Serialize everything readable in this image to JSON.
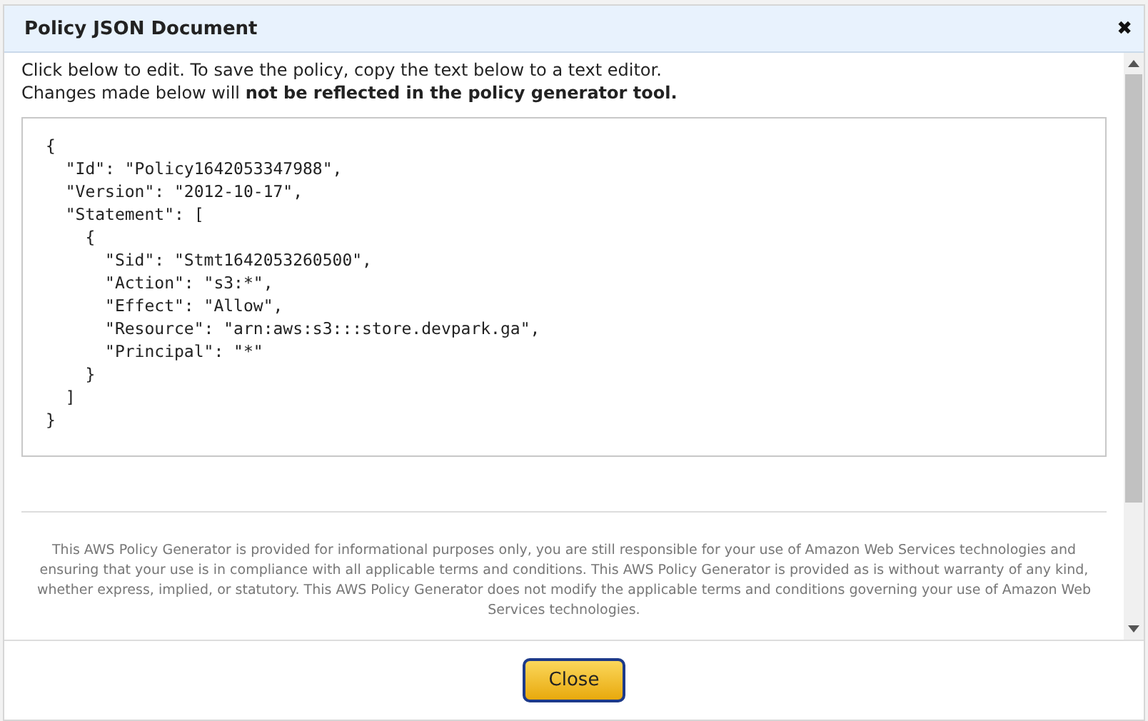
{
  "dialog": {
    "title": "Policy JSON Document",
    "close_icon": "✖"
  },
  "intro": {
    "line_1": "Click below to edit. To save the policy, copy the text below to a text editor.",
    "line_2": "Changes made below will **not be reflected in the policy generator tool.**"
  },
  "policy_lines": [
    "{",
    "  \"Id\": \"Policy1642053347988\",",
    "  \"Version\": \"2012-10-17\",",
    "  \"Statement\": [",
    "    {",
    "      \"Sid\": \"Stmt1642053260500\",",
    "      \"Action\": \"s3:*\",",
    "      \"Effect\": \"Allow\",",
    "      \"Resource\": \"arn:aws:s3:::store.devpark.ga\",",
    "      \"Principal\": \"*\"",
    "    }",
    "  ]",
    "}"
  ],
  "disclaimer": "This AWS Policy Generator is provided for informational purposes only, you are still responsible for your use of Amazon Web Services technologies and ensuring that your use is in compliance with all applicable terms and conditions. This AWS Policy Generator is provided as is without warranty of any kind, whether express, implied, or statutory. This AWS Policy Generator does not modify the applicable terms and conditions governing your use of Amazon Web Services technologies.",
  "buttons": [
    "Close"
  ]
}
